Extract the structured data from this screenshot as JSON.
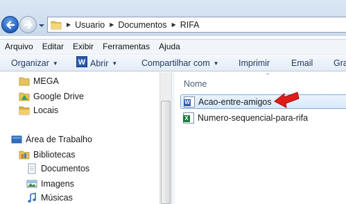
{
  "breadcrumb": {
    "items": [
      "Usuario",
      "Documentos",
      "RIFA"
    ]
  },
  "menubar": {
    "items": [
      "Arquivo",
      "Editar",
      "Exibir",
      "Ferramentas",
      "Ajuda"
    ]
  },
  "toolbar": {
    "organize": "Organizar",
    "open": "Abrir",
    "open_badge": "W",
    "share": "Compartilhar com",
    "print": "Imprimir",
    "email": "Email",
    "burn": "Gra"
  },
  "navpane": {
    "items": [
      {
        "label": "MEGA",
        "icon": "mega-folder-icon"
      },
      {
        "label": "Google Drive",
        "icon": "google-drive-icon"
      },
      {
        "label": "Locais",
        "icon": "locais-folder-icon"
      },
      {
        "label": "Área de Trabalho",
        "icon": "desktop-icon"
      },
      {
        "label": "Bibliotecas",
        "icon": "libraries-icon"
      },
      {
        "label": "Documentos",
        "icon": "documents-icon"
      },
      {
        "label": "Imagens",
        "icon": "pictures-icon"
      },
      {
        "label": "Músicas",
        "icon": "music-icon"
      }
    ]
  },
  "filelist": {
    "column_name": "Nome",
    "sort_glyph": "^",
    "files": [
      {
        "name": "Acao-entre-amigos",
        "type": "word",
        "badge": "W",
        "selected": true
      },
      {
        "name": "Numero-sequencial-para-rifa",
        "type": "excel",
        "badge": "X",
        "selected": false
      }
    ]
  },
  "colors": {
    "selection_border": "#84acdd",
    "arrow_red": "#e01b1b",
    "word_blue": "#2a5caa",
    "excel_green": "#1d7a3a"
  }
}
